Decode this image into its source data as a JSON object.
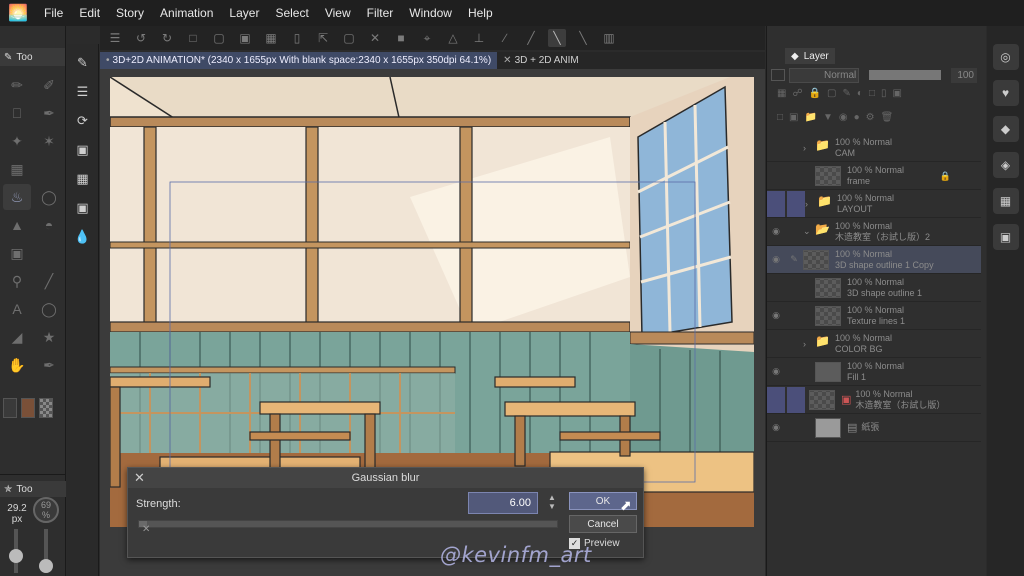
{
  "menu": [
    "File",
    "Edit",
    "Story",
    "Animation",
    "Layer",
    "Select",
    "View",
    "Filter",
    "Window",
    "Help"
  ],
  "left_panel": {
    "tab_label": "Too",
    "brush_tab_label": "Too",
    "brush_size": "29.2",
    "brush_unit": "px",
    "brush_opacity": "69",
    "brush_opacity_unit": "%",
    "main_color": "#3a3a3a",
    "sub_color": "#7a5038"
  },
  "document_tabs": [
    "3D+2D ANIMATION* (2340 x 1655px With blank space:2340 x 1655px 350dpi 64.1%)",
    "3D + 2D ANIM"
  ],
  "dialog": {
    "title": "Gaussian blur",
    "strength_label": "Strength:",
    "strength_value": "6.00",
    "strength_fraction": 0.02,
    "ok_label": "OK",
    "cancel_label": "Cancel",
    "preview_label": "Preview",
    "preview_checked": true
  },
  "watermark": "@kevinfm_art",
  "layer_panel": {
    "tab_label": "Layer",
    "blend_mode": "Normal",
    "opacity_value": "100",
    "layers": [
      {
        "percent": "100 %  Normal",
        "name": "CAM",
        "type": "folder"
      },
      {
        "percent": "100 %  Normal",
        "name": "frame",
        "type": "checker"
      },
      {
        "percent": "100 %  Normal",
        "name": "LAYOUT",
        "type": "folder"
      },
      {
        "percent": "100 %  Normal",
        "name": "木造教室（お試し版）2",
        "type": "folder"
      },
      {
        "percent": "100 %  Normal",
        "name": "3D shape outline 1 Copy",
        "type": "checker"
      },
      {
        "percent": "100 %  Normal",
        "name": "3D shape outline 1",
        "type": "checker"
      },
      {
        "percent": "100 %  Normal",
        "name": "Texture lines 1",
        "type": "checker"
      },
      {
        "percent": "100 %  Normal",
        "name": "COLOR BG",
        "type": "folder"
      },
      {
        "percent": "100 %  Normal",
        "name": "Fill 1",
        "type": "plain"
      },
      {
        "percent": "100 %  Normal",
        "name": "木造教室（お試し版）",
        "type": "model"
      },
      {
        "percent": "",
        "name": "紙張",
        "type": "plain"
      }
    ]
  }
}
